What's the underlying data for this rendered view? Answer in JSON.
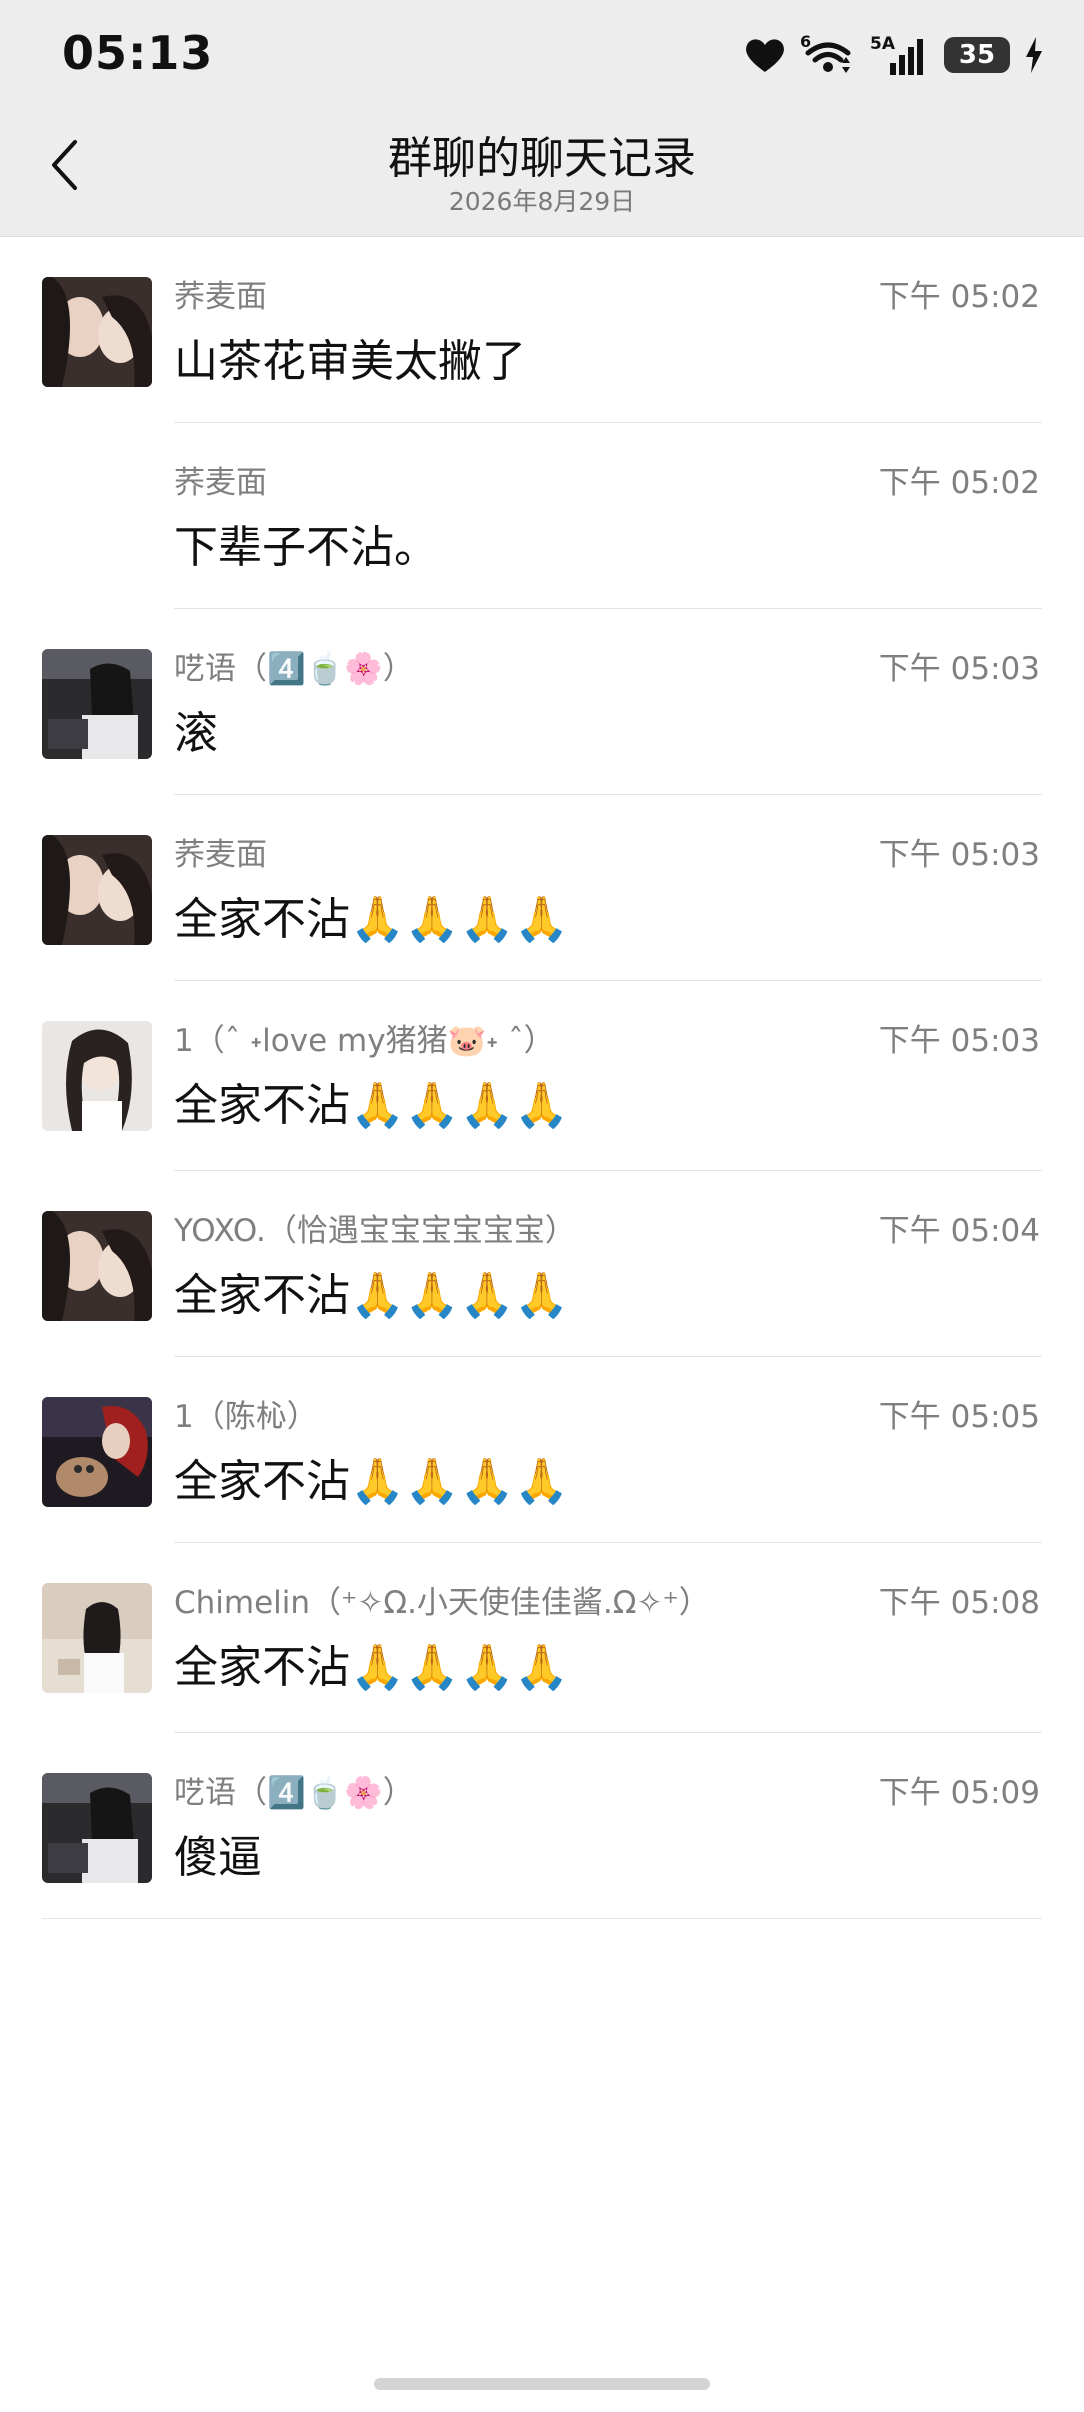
{
  "status_bar": {
    "time": "05:13",
    "network_label_1": "6",
    "network_label_2": "5A",
    "battery": "35"
  },
  "header": {
    "title": "群聊的聊天记录",
    "subtitle": "2026年8月29日",
    "back_icon": "chevron-left-icon"
  },
  "messages": [
    {
      "sender": "荞麦面",
      "time": "下午 05:02",
      "text": "山茶花审美太撇了",
      "avatar": "avatar-photo-1"
    },
    {
      "sender": "荞麦面",
      "time": "下午 05:02",
      "text": "下辈子不沾。",
      "avatar": ""
    },
    {
      "sender": "呓语（4️⃣🍵🌸）",
      "time": "下午 05:03",
      "text": "滚",
      "avatar": "avatar-photo-2"
    },
    {
      "sender": "荞麦面",
      "time": "下午 05:03",
      "text": "全家不沾🙏🙏🙏🙏",
      "avatar": "avatar-photo-1"
    },
    {
      "sender": "1（ˆ ˖love my猪猪🐷˖ ˆ）",
      "time": "下午 05:03",
      "text": "全家不沾🙏🙏🙏🙏",
      "avatar": "avatar-photo-3"
    },
    {
      "sender": "YOXO.（恰遇宝宝宝宝宝宝）",
      "time": "下午 05:04",
      "text": "全家不沾🙏🙏🙏🙏",
      "avatar": "avatar-photo-1"
    },
    {
      "sender": "1（陈杺）",
      "time": "下午 05:05",
      "text": "全家不沾🙏🙏🙏🙏",
      "avatar": "avatar-photo-4"
    },
    {
      "sender": "Chimelin（⁺✧Ω.小天使佳佳酱.Ω✧⁺）",
      "time": "下午 05:08",
      "text": "全家不沾🙏🙏🙏🙏",
      "avatar": "avatar-photo-5"
    },
    {
      "sender": "呓语（4️⃣🍵🌸）",
      "time": "下午 05:09",
      "text": "傻逼",
      "avatar": "avatar-photo-2"
    }
  ]
}
